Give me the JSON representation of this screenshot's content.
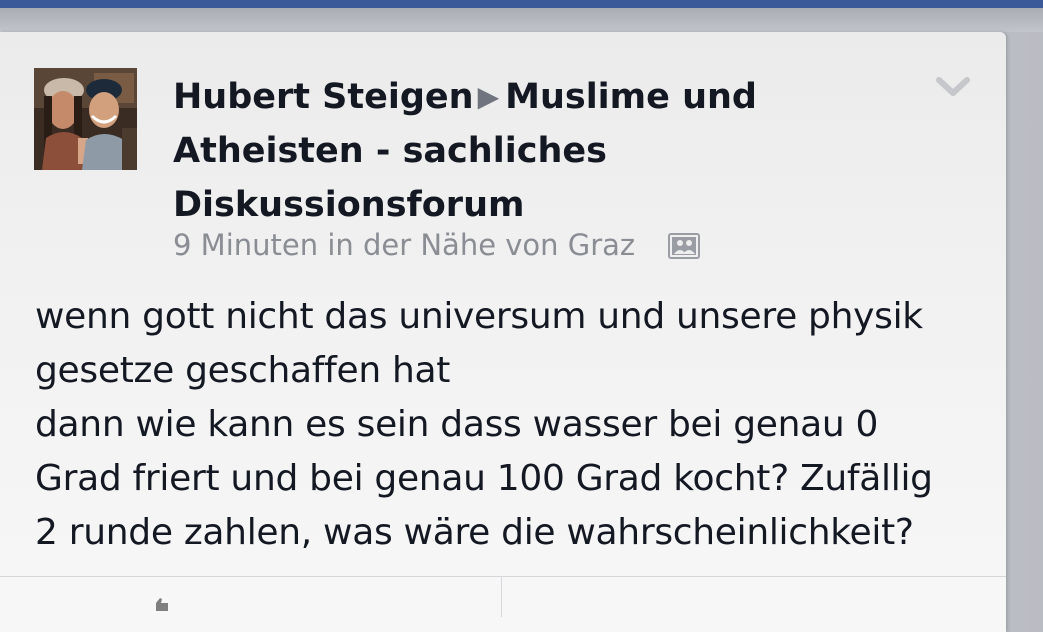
{
  "post": {
    "author": "Hubert Steigen",
    "separator_icon": "triangle-right-icon",
    "group_name": "Muslime und Atheisten - sachliches Diskussionsforum",
    "timestamp": "9 Minuten in der Nähe von Graz",
    "privacy_icon": "group-privacy-icon",
    "menu_icon": "chevron-down-icon",
    "text": "wenn gott nicht das universum und unsere physik\ngesetze geschaffen hat\ndann wie kann es sein dass wasser bei genau 0\nGrad friert und bei genau 100 Grad kocht? Zufällig\n2 runde zahlen, was wäre die wahrscheinlichkeit?"
  },
  "colors": {
    "brand_blue": "#3b5998",
    "text_primary": "#141823",
    "text_secondary": "#8a8d93"
  }
}
